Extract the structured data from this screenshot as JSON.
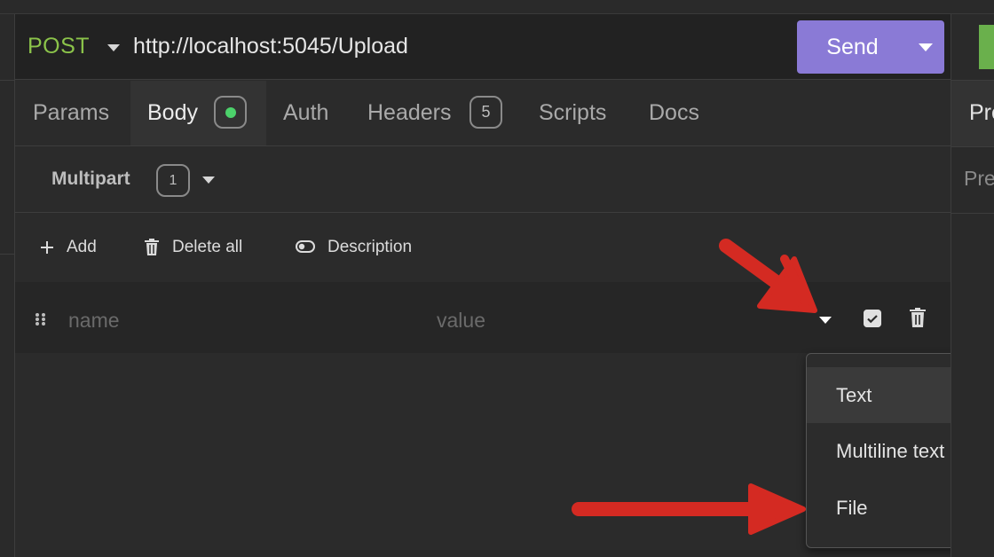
{
  "request": {
    "method": "POST",
    "url": "http://localhost:5045/Upload",
    "send_label": "Send"
  },
  "tabs": [
    {
      "label": "Params"
    },
    {
      "label": "Body",
      "active": true,
      "indicator": "green-dot"
    },
    {
      "label": "Auth"
    },
    {
      "label": "Headers",
      "badge": "5"
    },
    {
      "label": "Scripts"
    },
    {
      "label": "Docs"
    }
  ],
  "body_type": {
    "label": "Multipart",
    "count": "1"
  },
  "actions": {
    "add": "Add",
    "delete_all": "Delete all",
    "description": "Description"
  },
  "param_row": {
    "name_placeholder": "name",
    "value_placeholder": "value"
  },
  "dropdown": {
    "items": [
      "Text",
      "Multiline text",
      "File"
    ]
  },
  "right_pane": {
    "tab_text": "Pre",
    "sub_text": "Pre"
  },
  "colors": {
    "method": "#8bc34a",
    "send": "#8a7ad6",
    "body_dot": "#4cd26b",
    "annotation_arrow": "#d42a22"
  }
}
